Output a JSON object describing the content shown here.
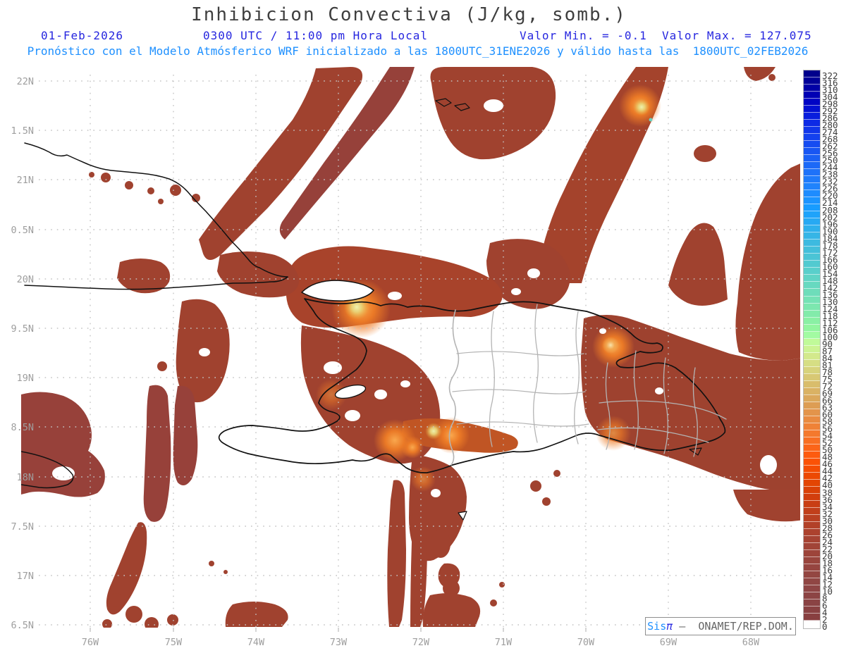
{
  "header": {
    "title": "Inhibicion Convectiva (J/kg, somb.)",
    "date": "01-Feb-2026",
    "time": "0300 UTC / 11:00 pm Hora Local",
    "minmax": "Valor Min. = -0.1  Valor Max. = 127.075",
    "forecast_line": "Pronóstico con el Modelo Atmósferico WRF inicializado a las 1800UTC_31ENE2026 y válido hasta las  1800UTC_02FEB2026"
  },
  "branding": {
    "sis": "Sis",
    "pi": "π",
    "rest": " –  ONAMET/REP.DOM."
  },
  "colors": {
    "title_text": "#3f3f3f",
    "meta_line1": "#2626df",
    "meta_line2": "#1e90ff",
    "axis_text": "#9e9e9e",
    "grid_dots": "#c4c4c4",
    "coastline": "#111111",
    "province_border": "#b4b4b4",
    "field_base_red": "#a0422f"
  },
  "chart_data": {
    "type": "heatmap",
    "field": "Convective Inhibition (CIN), shaded",
    "units": "J/kg",
    "value_min": "-0.1",
    "value_max": "127.075",
    "x_ticks": [
      "76W",
      "75W",
      "74W",
      "73W",
      "72W",
      "71W",
      "70W",
      "69W",
      "68W"
    ],
    "y_ticks": [
      "22N",
      "1.5N",
      "21N",
      "0.5N",
      "20N",
      "9.5N",
      "19N",
      "8.5N",
      "18N",
      "7.5N",
      "17N",
      "6.5N"
    ],
    "legend_position": "right",
    "grid": "dotted",
    "regions_shaded": "Filled CIN contours over eastern Cuba, Haiti, the Dominican Republic and surrounding Atlantic/Caribbean waters; DR interior mostly clear",
    "colorbar": [
      {
        "v": "322",
        "c": "#00008c"
      },
      {
        "v": "316",
        "c": "#000098"
      },
      {
        "v": "310",
        "c": "#0000a6"
      },
      {
        "v": "304",
        "c": "#0000b4"
      },
      {
        "v": "298",
        "c": "#0004c4"
      },
      {
        "v": "292",
        "c": "#0310d2"
      },
      {
        "v": "286",
        "c": "#081ddd"
      },
      {
        "v": "280",
        "c": "#0d2ae5"
      },
      {
        "v": "274",
        "c": "#1136ea"
      },
      {
        "v": "268",
        "c": "#1441ee"
      },
      {
        "v": "262",
        "c": "#164cf1"
      },
      {
        "v": "256",
        "c": "#1856f3"
      },
      {
        "v": "250",
        "c": "#1a60f5"
      },
      {
        "v": "244",
        "c": "#1c69f7"
      },
      {
        "v": "238",
        "c": "#1e72f9"
      },
      {
        "v": "232",
        "c": "#1f7bfb"
      },
      {
        "v": "226",
        "c": "#2083fc"
      },
      {
        "v": "220",
        "c": "#1e8cfe"
      },
      {
        "v": "214",
        "c": "#1b94ff"
      },
      {
        "v": "208",
        "c": "#189cff"
      },
      {
        "v": "202",
        "c": "#1fa3fa"
      },
      {
        "v": "196",
        "c": "#27a9f3"
      },
      {
        "v": "190",
        "c": "#2fb0ec"
      },
      {
        "v": "184",
        "c": "#36b5e6"
      },
      {
        "v": "178",
        "c": "#3dbae0"
      },
      {
        "v": "172",
        "c": "#44bfda"
      },
      {
        "v": "166",
        "c": "#4bc4d5"
      },
      {
        "v": "160",
        "c": "#52cad0"
      },
      {
        "v": "154",
        "c": "#59cfcb"
      },
      {
        "v": "148",
        "c": "#60d4c5"
      },
      {
        "v": "142",
        "c": "#67d9c0"
      },
      {
        "v": "136",
        "c": "#6eddba"
      },
      {
        "v": "130",
        "c": "#75e2b5"
      },
      {
        "v": "124",
        "c": "#7ce7af"
      },
      {
        "v": "118",
        "c": "#83ebaa"
      },
      {
        "v": "112",
        "c": "#8af0a4"
      },
      {
        "v": "106",
        "c": "#92f59f"
      },
      {
        "v": "100",
        "c": "#a2fba2"
      },
      {
        "v": "90",
        "c": "#c0fa99"
      },
      {
        "v": "87",
        "c": "#ccf393"
      },
      {
        "v": "84",
        "c": "#d3e98c"
      },
      {
        "v": "81",
        "c": "#d6de84"
      },
      {
        "v": "78",
        "c": "#d7d37c"
      },
      {
        "v": "75",
        "c": "#d8c874"
      },
      {
        "v": "72",
        "c": "#d9bd6c"
      },
      {
        "v": "69",
        "c": "#dab264"
      },
      {
        "v": "66",
        "c": "#dba85c"
      },
      {
        "v": "63",
        "c": "#dd9d54"
      },
      {
        "v": "60",
        "c": "#e3944b"
      },
      {
        "v": "58",
        "c": "#e98b41"
      },
      {
        "v": "56",
        "c": "#ef8237"
      },
      {
        "v": "54",
        "c": "#f4792d"
      },
      {
        "v": "52",
        "c": "#f86f23"
      },
      {
        "v": "50",
        "c": "#fb6519"
      },
      {
        "v": "48",
        "c": "#fd5b0f"
      },
      {
        "v": "46",
        "c": "#fb5206"
      },
      {
        "v": "44",
        "c": "#f44d03"
      },
      {
        "v": "42",
        "c": "#ec4903"
      },
      {
        "v": "40",
        "c": "#e34503"
      },
      {
        "v": "38",
        "c": "#da4107"
      },
      {
        "v": "36",
        "c": "#d23e0d"
      },
      {
        "v": "34",
        "c": "#c93e14"
      },
      {
        "v": "32",
        "c": "#c13f1b"
      },
      {
        "v": "30",
        "c": "#b94022"
      },
      {
        "v": "28",
        "c": "#b24128"
      },
      {
        "v": "26",
        "c": "#ac422e"
      },
      {
        "v": "24",
        "c": "#a64333"
      },
      {
        "v": "22",
        "c": "#a14437"
      },
      {
        "v": "20",
        "c": "#9d443a"
      },
      {
        "v": "18",
        "c": "#99453d"
      },
      {
        "v": "16",
        "c": "#964540"
      },
      {
        "v": "14",
        "c": "#934642"
      },
      {
        "v": "12",
        "c": "#904644"
      },
      {
        "v": "10",
        "c": "#8e4545"
      },
      {
        "v": "8",
        "c": "#8c4444"
      },
      {
        "v": "6",
        "c": "#8a4344"
      },
      {
        "v": "4",
        "c": "#894142"
      },
      {
        "v": "2",
        "c": "#883f40"
      },
      {
        "v": "0",
        "c": "#ffffff"
      }
    ]
  }
}
